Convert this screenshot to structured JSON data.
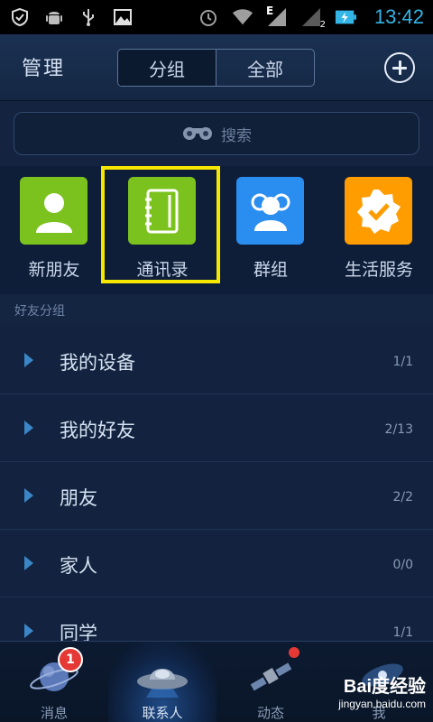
{
  "status_bar": {
    "time": "13:42",
    "signal_letter": "E",
    "sim_slot": "2",
    "left_icons": [
      "shield-icon",
      "android-icon",
      "usb-icon",
      "image-icon"
    ],
    "right_icons": [
      "alarm-icon",
      "wifi-icon",
      "signal-icon",
      "signal-2-icon",
      "battery-charging-icon"
    ]
  },
  "header": {
    "manage_label": "管理",
    "tabs": [
      {
        "label": "分组",
        "selected": true
      },
      {
        "label": "全部",
        "selected": false
      }
    ],
    "add_icon": "plus-circle-icon"
  },
  "search": {
    "placeholder": "搜索",
    "icon": "binoculars-icon"
  },
  "quick_tiles": [
    {
      "label": "新朋友",
      "icon": "person-icon",
      "color": "#7cc21f"
    },
    {
      "label": "通讯录",
      "icon": "address-book-icon",
      "color": "#7cc21f",
      "highlighted": true
    },
    {
      "label": "群组",
      "icon": "group-icon",
      "color": "#2a8df0"
    },
    {
      "label": "生活服务",
      "icon": "badge-check-icon",
      "color": "#ff9d00"
    }
  ],
  "highlight_color": "#f5e700",
  "section_title": "好友分组",
  "groups": [
    {
      "name": "我的设备",
      "count": "1/1"
    },
    {
      "name": "我的好友",
      "count": "2/13"
    },
    {
      "name": "朋友",
      "count": "2/2"
    },
    {
      "name": "家人",
      "count": "0/0"
    },
    {
      "name": "同学",
      "count": "1/1"
    }
  ],
  "bottom_nav": [
    {
      "label": "消息",
      "icon": "planet-icon",
      "badge": "1"
    },
    {
      "label": "联系人",
      "icon": "ufo-icon",
      "active": true
    },
    {
      "label": "动态",
      "icon": "satellite-icon",
      "dot": true
    },
    {
      "label": "我",
      "icon": "galaxy-icon"
    }
  ],
  "watermark": {
    "main": "Bai度经验",
    "sub": "jingyan.baidu.com"
  }
}
